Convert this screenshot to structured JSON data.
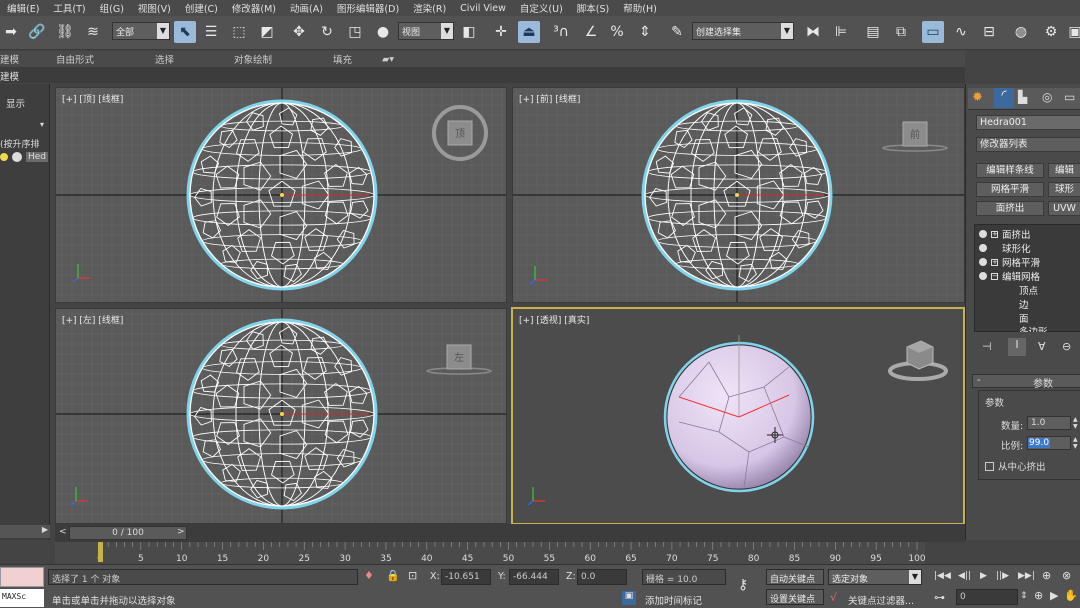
{
  "menu": [
    "编辑(E)",
    "工具(T)",
    "组(G)",
    "视图(V)",
    "创建(C)",
    "修改器(M)",
    "动画(A)",
    "图形编辑器(D)",
    "渲染(R)",
    "Civil View",
    "自定义(U)",
    "脚本(S)",
    "帮助(H)"
  ],
  "toolbar": {
    "selection_filter": "全部",
    "ref_coord": "视图",
    "named_selection": "创建选择集"
  },
  "ribbon": {
    "tabs": [
      "建模",
      "自由形式",
      "选择",
      "对象绘制",
      "填充"
    ],
    "sub_tab": "建模"
  },
  "left_panel": {
    "display_tab": "显示",
    "sort_label": "(按升序排",
    "item": "Hed"
  },
  "viewports": {
    "top": "[+] [顶] [线框]",
    "front": "[+] [前] [线框]",
    "left": "[+] [左] [线框]",
    "persp": "[+] [透视] [真实]",
    "viewcube_left": "左",
    "viewcube_front": "前",
    "viewcube_top": "顶"
  },
  "command_panel": {
    "object_name": "Hedra001",
    "modifier_list": "修改器列表",
    "quick_buttons": [
      "编辑样条线",
      "编辑",
      "网格平滑",
      "球形",
      "面挤出",
      "UVW"
    ],
    "stack": [
      "面挤出",
      "球形化",
      "网格平滑",
      "编辑网格"
    ],
    "sub_objects": [
      "顶点",
      "边",
      "面",
      "多边形"
    ],
    "rollout_title": "参数",
    "group_title": "参数",
    "amount_label": "数量:",
    "amount_value": "1.0",
    "scale_label": "比例:",
    "scale_value": "99.0",
    "from_center": "从中心挤出"
  },
  "timeline": {
    "frame_display": "0 / 100",
    "ticks": [
      "0",
      "5",
      "10",
      "15",
      "20",
      "25",
      "30",
      "35",
      "40",
      "45",
      "50",
      "55",
      "60",
      "65",
      "70",
      "75",
      "80",
      "85",
      "90",
      "95",
      "100"
    ]
  },
  "status": {
    "script_label": "MAXSc",
    "selection_msg": "选择了 1 个 对象",
    "prompt_msg": "单击或单击并拖动以选择对象",
    "x_label": "X:",
    "x_value": "-10.651",
    "y_label": "Y:",
    "y_value": "-66.444",
    "z_label": "Z:",
    "z_value": "0.0",
    "grid": "栅格 = 10.0",
    "add_time_tag": "添加时间标记",
    "auto_key": "自动关键点",
    "set_key": "设置关键点",
    "key_mode": "选定对象",
    "key_filters": "关键点过滤器...",
    "frame_value": "0"
  },
  "colors": {
    "viewport_bg": "#5a5a5a",
    "wire": "#ffffff",
    "sphere_edge": "#7fd4ec",
    "sphere_fill": "#d7c6e6",
    "active_border": "#c8b34a",
    "accent": "#9bb9d8"
  }
}
